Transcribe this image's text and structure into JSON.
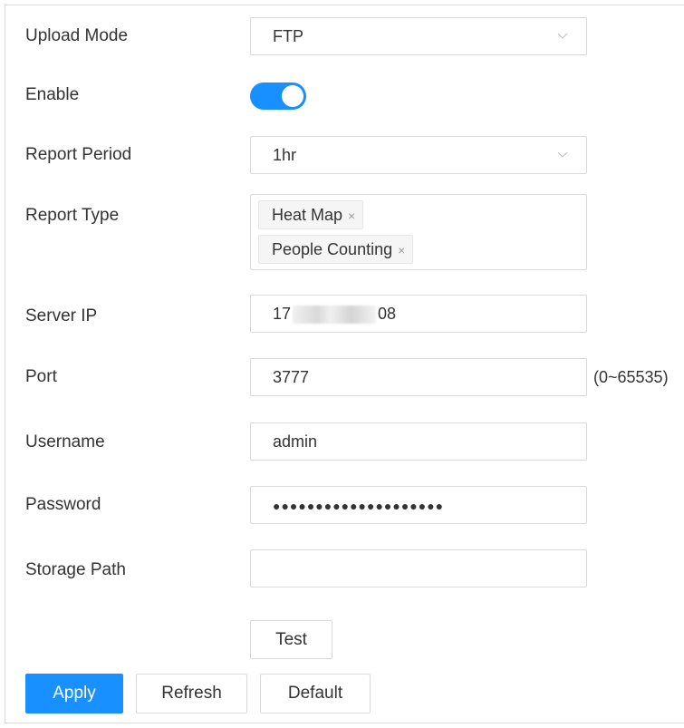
{
  "form": {
    "upload_mode": {
      "label": "Upload Mode",
      "value": "FTP"
    },
    "enable": {
      "label": "Enable",
      "on": true
    },
    "report_period": {
      "label": "Report Period",
      "value": "1hr"
    },
    "report_type": {
      "label": "Report Type",
      "tags": [
        "Heat Map",
        "People Counting"
      ],
      "remove_glyph": "×"
    },
    "server_ip": {
      "label": "Server IP",
      "value_prefix": "17",
      "value_suffix": "08"
    },
    "port": {
      "label": "Port",
      "value": "3777",
      "range_hint": "(0~65535)"
    },
    "username": {
      "label": "Username",
      "value": "admin"
    },
    "password": {
      "label": "Password",
      "value_masked": "●●●●●●●●●●●●●●●●●●●●"
    },
    "storage_path": {
      "label": "Storage Path",
      "value": ""
    }
  },
  "buttons": {
    "test": "Test",
    "apply": "Apply",
    "refresh": "Refresh",
    "default": "Default"
  },
  "colors": {
    "primary": "#1890ff",
    "border": "#d9d9d9",
    "text": "#333333"
  },
  "icons": {
    "dropdown": "chevron-down-icon",
    "tag_remove": "close-icon"
  }
}
